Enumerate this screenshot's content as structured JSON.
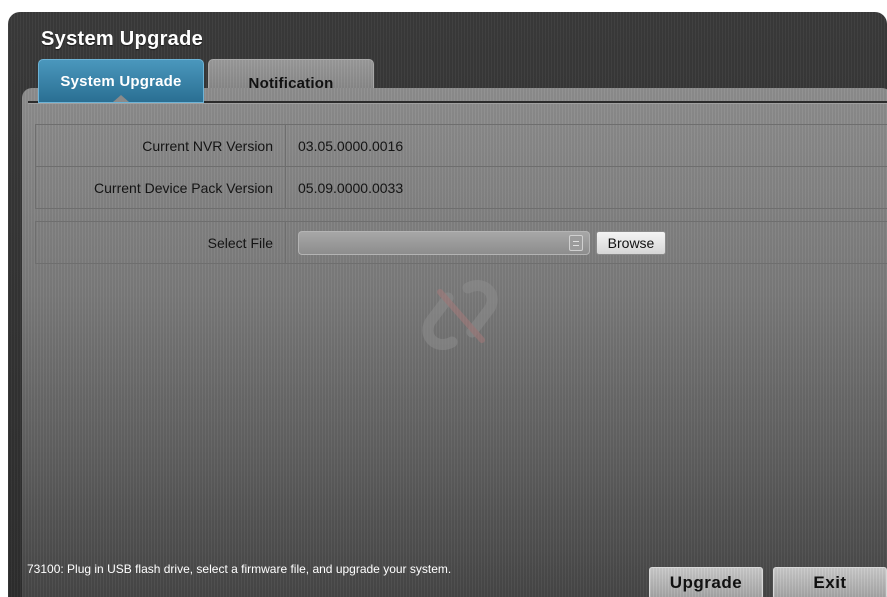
{
  "window": {
    "title": "System Upgrade"
  },
  "tabs": [
    {
      "label": "System Upgrade",
      "active": true
    },
    {
      "label": "Notification",
      "active": false
    }
  ],
  "info": {
    "nvr_version_label": "Current NVR Version",
    "nvr_version_value": "03.05.0000.0016",
    "device_pack_label": "Current Device Pack Version",
    "device_pack_value": "05.09.0000.0033"
  },
  "file_select": {
    "label": "Select File",
    "value": "",
    "browse_label": "Browse"
  },
  "status": {
    "message": "73100: Plug in USB flash drive, select a firmware file, and upgrade your system."
  },
  "actions": {
    "upgrade_label": "Upgrade",
    "exit_label": "Exit"
  },
  "colors": {
    "active_tab": "#2a6f93",
    "panel": "#7a7a7a",
    "window": "#2e2e2e"
  },
  "icons": {
    "file": "file-icon",
    "watermark": "logo-watermark-icon"
  }
}
